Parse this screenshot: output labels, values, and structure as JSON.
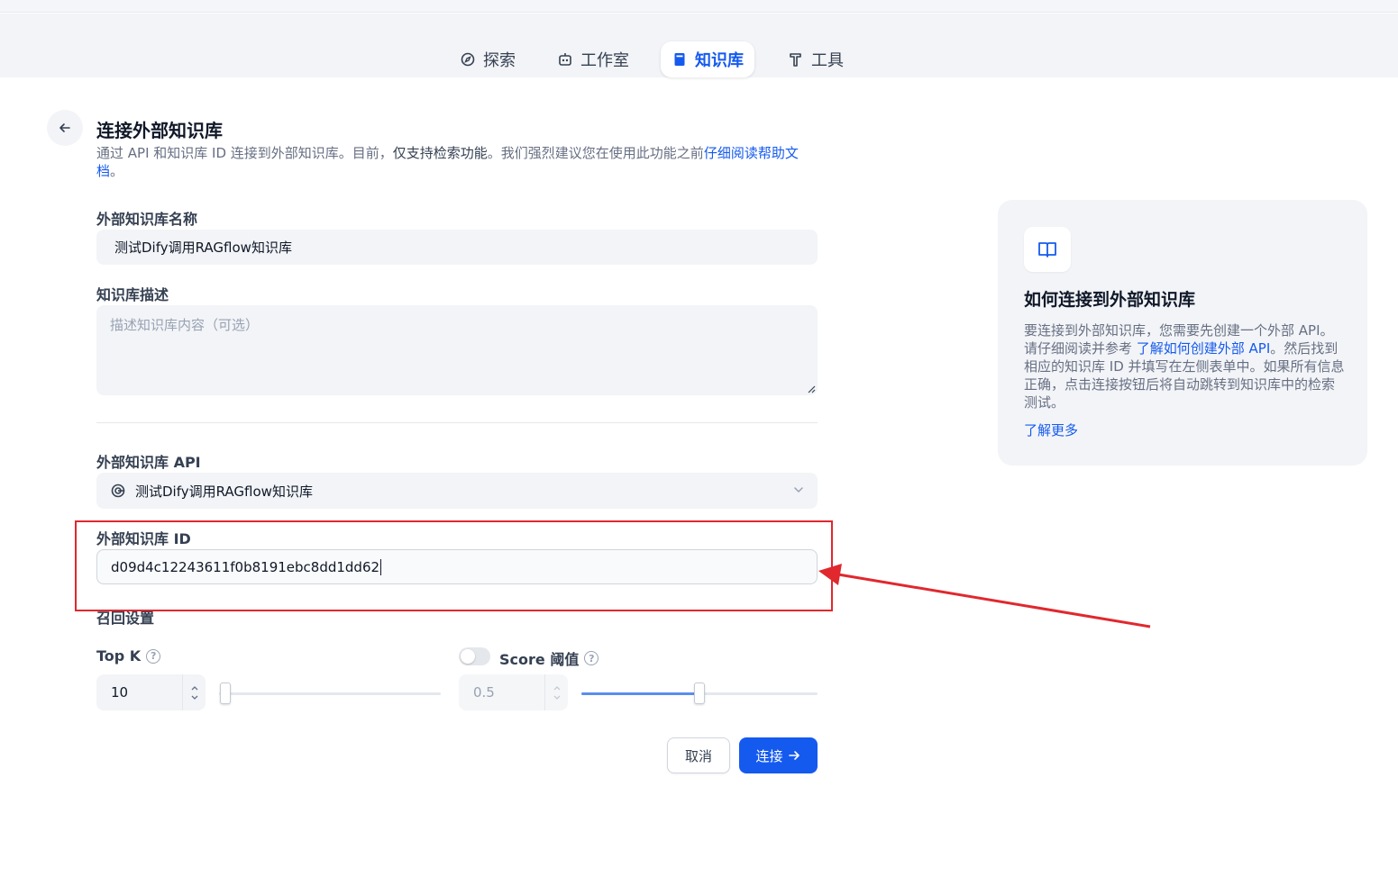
{
  "nav": {
    "explore": "探索",
    "studio": "工作室",
    "knowledge": "知识库",
    "tools": "工具"
  },
  "page": {
    "title": "连接外部知识库",
    "desc_part1": "通过 API 和知识库 ID 连接到外部知识库。目前，",
    "desc_strong": "仅支持检索功能",
    "desc_part2": "。我们强烈建议您在使用此功能之前",
    "desc_link": "仔细阅读帮助文档",
    "desc_end": "。"
  },
  "form": {
    "name_label": "外部知识库名称",
    "name_value": "测试Dify调用RAGflow知识库",
    "desc_label": "知识库描述",
    "desc_placeholder": "描述知识库内容（可选）",
    "api_label": "外部知识库 API",
    "api_value": "测试Dify调用RAGflow知识库",
    "id_label": "外部知识库 ID",
    "id_value": "d09d4c12243611f0b8191ebc8dd1dd62",
    "retrieval_label": "召回设置",
    "topk_label": "Top K",
    "topk_value": "10",
    "score_label": "Score 阈值",
    "score_value": "0.5",
    "score_enabled": false,
    "cancel": "取消",
    "connect": "连接"
  },
  "help_card": {
    "title": "如何连接到外部知识库",
    "text_part1": "要连接到外部知识库，您需要先创建一个外部 API。请仔细阅读并参考 ",
    "text_link": "了解如何创建外部 API",
    "text_part2": "。然后找到相应的知识库 ID 并填写在左侧表单中。如果所有信息正确，点击连接按钮后将自动跳转到知识库中的检索测试。",
    "more": "了解更多"
  },
  "colors": {
    "accent": "#155aef",
    "annotation": "#e0282e"
  }
}
